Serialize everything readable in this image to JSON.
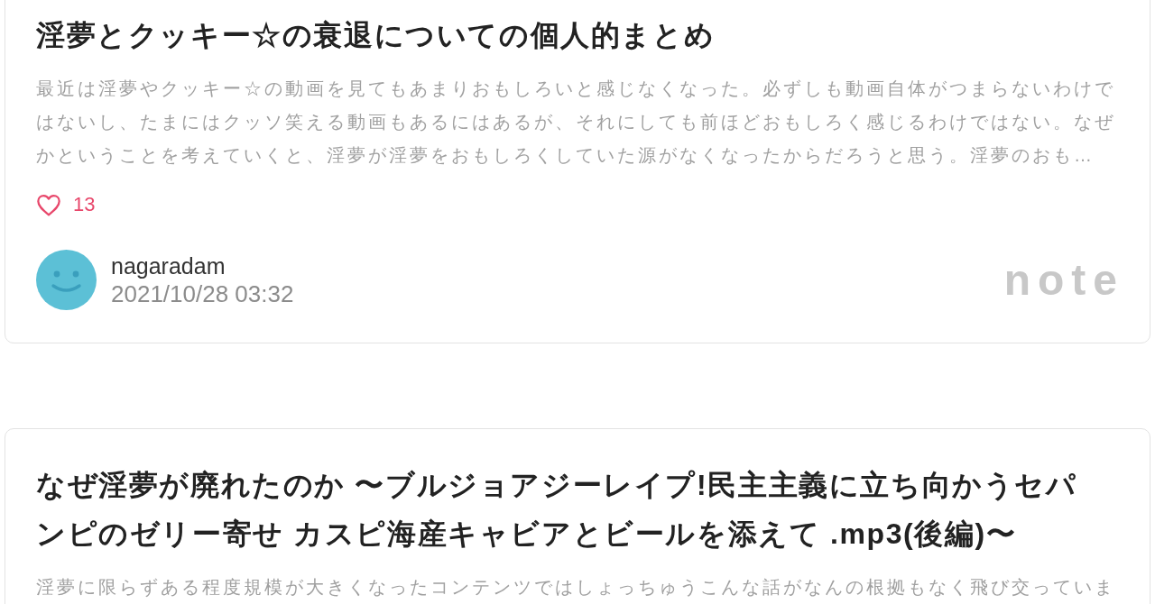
{
  "cards": [
    {
      "title": "淫夢とクッキー☆の衰退についての個人的まとめ",
      "excerpt": "最近は淫夢やクッキー☆の動画を見てもあまりおもしろいと感じなくなった。必ずしも動画自体がつまらないわけではないし、たまにはクッソ笑える動画もあるにはあるが、それにしても前ほどおもしろく感じるわけではない。なぜかということを考えていくと、淫夢が淫夢をおもしろくしていた源がなくなったからだろうと思う。淫夢のおも…",
      "likes": {
        "count": "13",
        "liked": false
      },
      "author": {
        "name": "nagaradam",
        "date": "2021/10/28 03:32"
      },
      "logo": "note"
    },
    {
      "title": "なぜ淫夢が廃れたのか 〜ブルジョアジーレイプ!民主主義に立ち向かうセパンピのゼリー寄せ カスピ海産キャビアとビールを添えて .mp3(後編)〜",
      "excerpt": "淫夢に限らずある程度規模が大きくなったコンテンツではしょっちゅうこんな話がなんの根拠もなく飛び交っていま"
    }
  ]
}
